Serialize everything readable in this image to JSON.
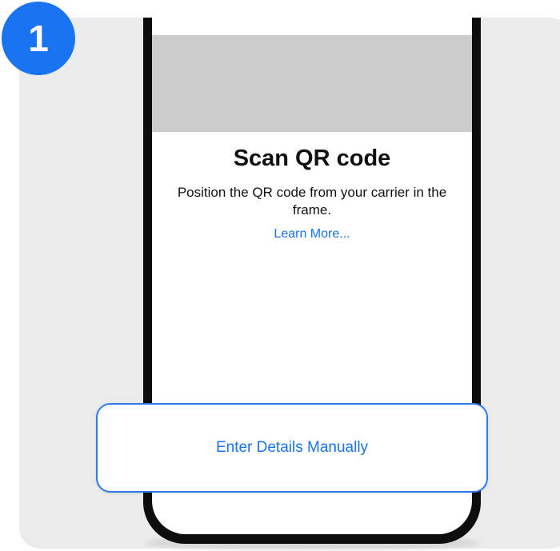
{
  "step": {
    "number": "1",
    "badge_color": "#1a73f0"
  },
  "screen": {
    "title": "Scan QR code",
    "subtitle": "Position the QR code from your carrier in the frame.",
    "learn_more_label": "Learn More..."
  },
  "manual_entry": {
    "label": "Enter Details Manually"
  },
  "colors": {
    "accent": "#1a73e8",
    "panel_bg": "#ebebeb",
    "camera_placeholder": "#cccccc",
    "phone_frame": "#0d0d0d"
  }
}
